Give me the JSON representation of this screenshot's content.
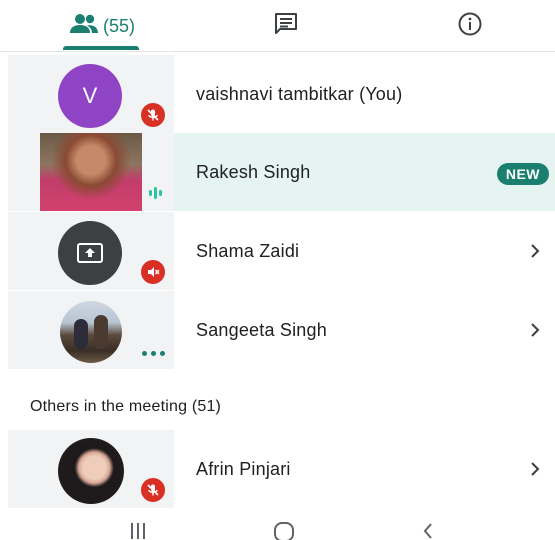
{
  "tabs": {
    "people_count": "(55)",
    "people_icon": "people-icon",
    "chat_icon": "chat-icon",
    "info_icon": "info-icon",
    "accent_color": "#1a7f6e"
  },
  "participants": [
    {
      "name": "vaishnavi tambitkar (You)",
      "avatar_letter": "V",
      "muted": true
    },
    {
      "name": "Rakesh Singh",
      "badge": "NEW",
      "speaking": true
    },
    {
      "name": "Shama Zaidi",
      "presenting": true,
      "muted": true
    },
    {
      "name": "Sangeeta Singh",
      "more": true
    }
  ],
  "others": {
    "title": "Others in the meeting (51)",
    "participants": [
      {
        "name": "Afrin Pinjari",
        "muted": true
      }
    ]
  },
  "navbar": {
    "recents_icon": "recents-icon",
    "home_icon": "home-icon",
    "back_icon": "back-icon"
  }
}
